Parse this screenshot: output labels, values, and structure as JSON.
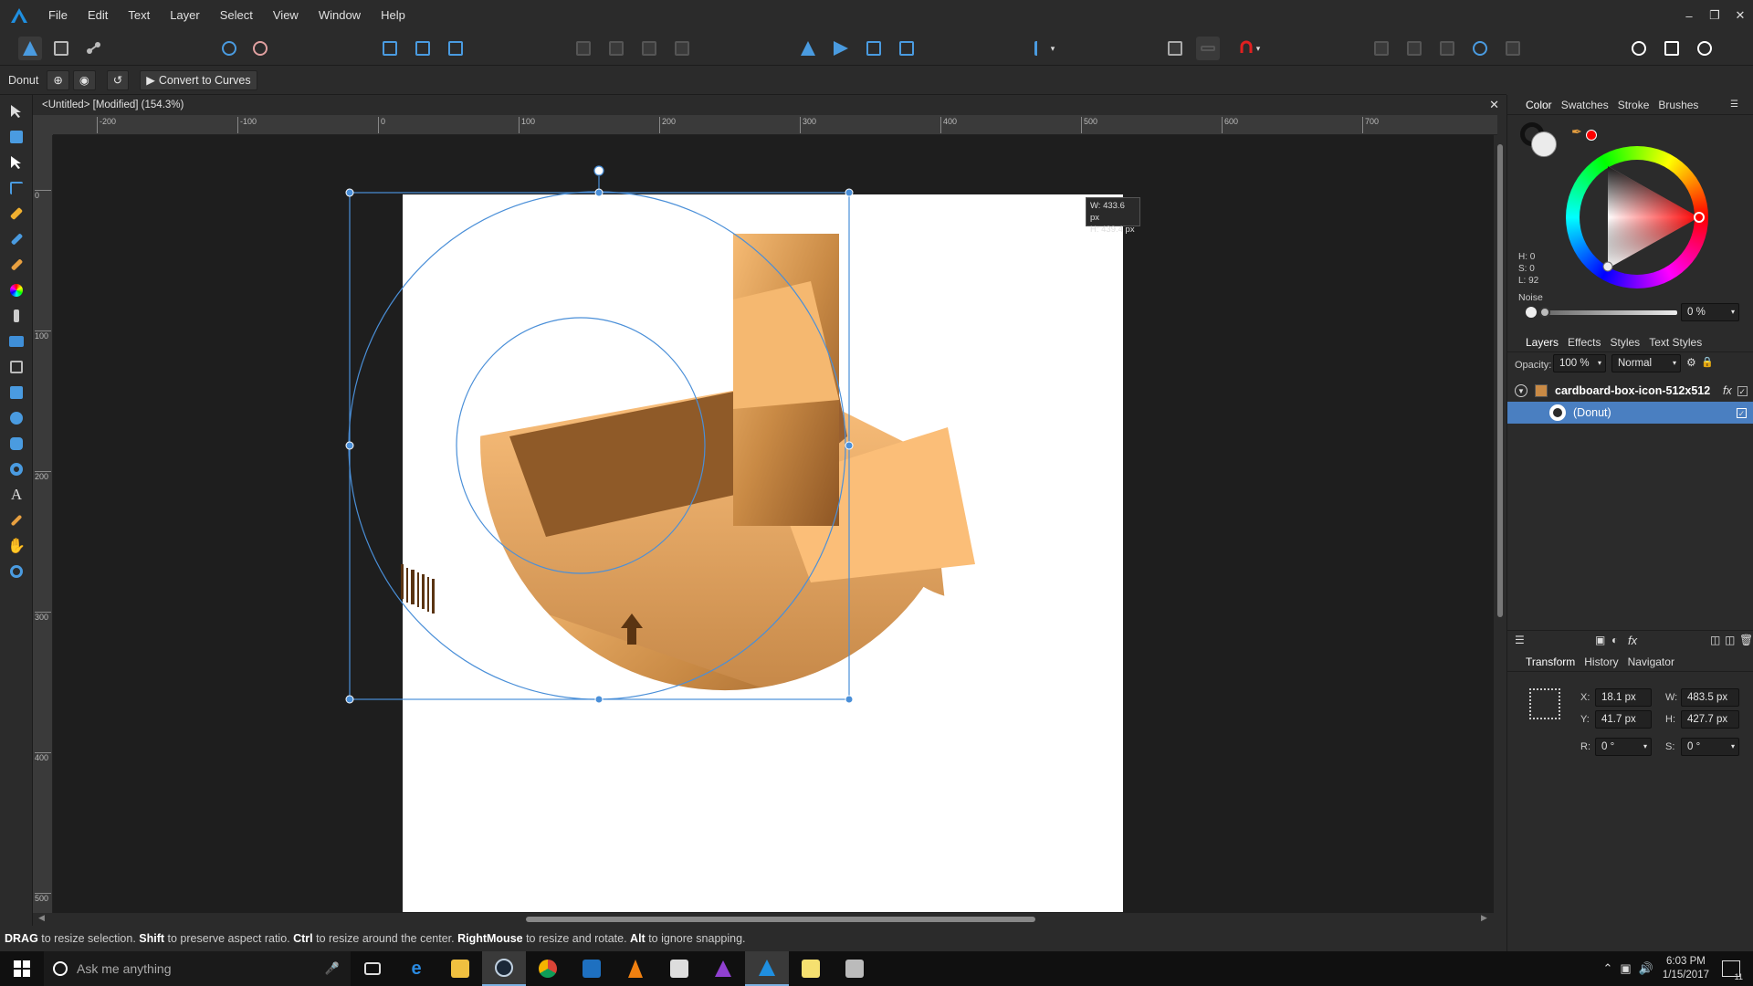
{
  "menubar": {
    "items": [
      "File",
      "Edit",
      "Text",
      "Layer",
      "Select",
      "View",
      "Window",
      "Help"
    ]
  },
  "context_toolbar": {
    "selection_name": "Donut",
    "convert_label": "Convert to Curves"
  },
  "document": {
    "title": "<Untitled> [Modified] (154.3%)",
    "size_tooltip_w": "W: 433.6 px",
    "size_tooltip_h": "H: 439.4 px"
  },
  "ruler": {
    "h_ticks": [
      "-200",
      "-100",
      "0",
      "100",
      "200",
      "300",
      "400",
      "500",
      "600",
      "700"
    ],
    "v_ticks": [
      "0",
      "100",
      "200",
      "300",
      "400",
      "500"
    ]
  },
  "status_bar": {
    "parts": [
      {
        "text": "DRAG",
        "bold": true
      },
      {
        "text": " to resize selection. ",
        "bold": false
      },
      {
        "text": "Shift",
        "bold": true
      },
      {
        "text": " to preserve aspect ratio. ",
        "bold": false
      },
      {
        "text": "Ctrl",
        "bold": true
      },
      {
        "text": " to resize around the center. ",
        "bold": false
      },
      {
        "text": "RightMouse",
        "bold": true
      },
      {
        "text": " to resize and rotate. ",
        "bold": false
      },
      {
        "text": "Alt",
        "bold": true
      },
      {
        "text": " to ignore snapping.",
        "bold": false
      }
    ]
  },
  "color_panel": {
    "tabs": [
      "Color",
      "Swatches",
      "Stroke",
      "Brushes"
    ],
    "h": "H: 0",
    "s": "S: 0",
    "l": "L: 92",
    "noise_label": "Noise",
    "noise_value": "0 %"
  },
  "layers_panel": {
    "tabs": [
      "Layers",
      "Effects",
      "Styles",
      "Text Styles"
    ],
    "opacity_label": "Opacity:",
    "opacity_value": "100 %",
    "blend_mode": "Normal",
    "layers": [
      {
        "name": "cardboard-box-icon-512x512",
        "selected": false
      },
      {
        "name": "(Donut)",
        "selected": true
      }
    ]
  },
  "transform_panel": {
    "tabs": [
      "Transform",
      "History",
      "Navigator"
    ],
    "x_label": "X:",
    "x": "18.1 px",
    "y_label": "Y:",
    "y": "41.7 px",
    "w_label": "W:",
    "w": "483.5 px",
    "h_label": "H:",
    "h": "427.7 px",
    "r_label": "R:",
    "r": "0 °",
    "s_label": "S:",
    "s": "0 °"
  },
  "taskbar": {
    "search_placeholder": "Ask me anything",
    "time": "6:03 PM",
    "date": "1/15/2017",
    "notification_count": "11"
  },
  "colors": {
    "accent": "#4a9be0",
    "selected_layer": "#4a7fc1",
    "box_light": "#f5b870",
    "box_dark": "#a86a30"
  }
}
